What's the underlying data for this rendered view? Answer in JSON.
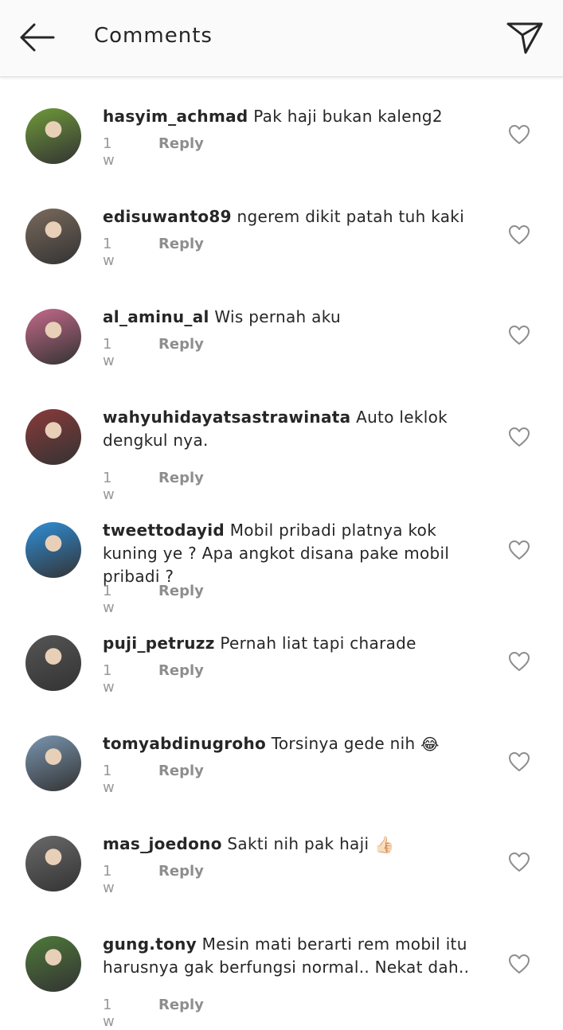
{
  "header": {
    "title": "Comments",
    "back_icon": "arrow-left-icon",
    "send_icon": "paper-plane-icon"
  },
  "comments": [
    {
      "user": "hasyim_achmad",
      "text": "Pak haji bukan kaleng2",
      "time": "1 w",
      "reply": "Reply",
      "avatar_color": "#6f9a3a"
    },
    {
      "user": "edisuwanto89",
      "text": "ngerem dikit patah tuh kaki",
      "time": "1 w",
      "reply": "Reply",
      "avatar_color": "#7a6a5c"
    },
    {
      "user": "al_aminu_al",
      "text": "Wis pernah aku",
      "time": "1 w",
      "reply": "Reply",
      "avatar_color": "#c46a8a"
    },
    {
      "user": "wahyuhidayatsastrawinata",
      "text": "Auto leklok dengkul nya.",
      "time": "1 w",
      "reply": "Reply",
      "avatar_color": "#8a3a3a"
    },
    {
      "user": "tweettodayid",
      "text": "Mobil pribadi platnya kok kuning ye ? Apa angkot disana pake mobil pribadi ?",
      "time": "1 w",
      "reply": "Reply",
      "avatar_color": "#2f8fd8"
    },
    {
      "user": "puji_petruzz",
      "text": "Pernah liat tapi charade",
      "time": "1 w",
      "reply": "Reply",
      "avatar_color": "#555555"
    },
    {
      "user": "tomyabdinugroho",
      "text": "Torsinya gede nih",
      "emoji": "😂",
      "time": "1 w",
      "reply": "Reply",
      "avatar_color": "#7a96b0"
    },
    {
      "user": "mas_joedono",
      "text": "Sakti nih pak haji",
      "emoji": "👍🏻",
      "time": "1 w",
      "reply": "Reply",
      "avatar_color": "#6a6a6a"
    },
    {
      "user": "gung.tony",
      "text": "Mesin mati berarti rem mobil itu harusnya gak berfungsi normal.. Nekat dah..",
      "time": "1 w",
      "reply": "Reply",
      "avatar_color": "#4f7a3a"
    }
  ]
}
